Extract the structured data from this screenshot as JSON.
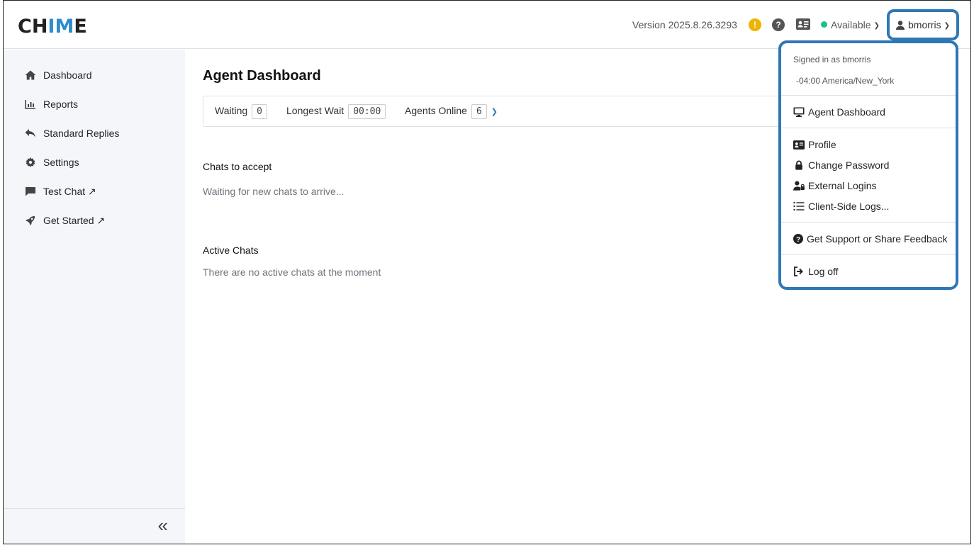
{
  "header": {
    "logo_prefix": "CH",
    "logo_highlight": "IM",
    "logo_suffix": "E",
    "version": "Version 2025.8.26.3293",
    "warning_icon": "!",
    "help_icon": "?",
    "status_label": "Available",
    "username": "bmorris"
  },
  "sidebar": {
    "items": [
      {
        "label": "Dashboard",
        "icon": "home-icon"
      },
      {
        "label": "Reports",
        "icon": "bar-chart-icon"
      },
      {
        "label": "Standard Replies",
        "icon": "reply-icon"
      },
      {
        "label": "Settings",
        "icon": "gear-icon"
      },
      {
        "label": "Test Chat ↗",
        "icon": "chat-icon"
      },
      {
        "label": "Get Started ↗",
        "icon": "rocket-icon"
      }
    ],
    "collapse_icon": "«"
  },
  "main": {
    "title": "Agent Dashboard",
    "stats": {
      "waiting_label": "Waiting",
      "waiting_value": "0",
      "longest_wait_label": "Longest Wait",
      "longest_wait_value": "00:00",
      "agents_online_label": "Agents Online",
      "agents_online_value": "6"
    },
    "chats_to_accept": {
      "heading": "Chats to accept",
      "empty_text": "Waiting for new chats to arrive..."
    },
    "active_chats": {
      "heading": "Active Chats",
      "empty_text": "There are no active chats at the moment"
    }
  },
  "user_menu": {
    "signed_in_as": "Signed in as bmorris",
    "timezone": "-04:00 America/New_York",
    "items": [
      {
        "label": "Agent Dashboard",
        "icon": "monitor-icon"
      },
      {
        "label": "Profile",
        "icon": "id-card-icon"
      },
      {
        "label": "Change Password",
        "icon": "lock-icon"
      },
      {
        "label": "External Logins",
        "icon": "user-lock-icon"
      },
      {
        "label": "Client-Side Logs...",
        "icon": "list-icon"
      },
      {
        "label": "Get Support or Share Feedback",
        "icon": "question-circle-icon"
      },
      {
        "label": "Log off",
        "icon": "sign-out-icon"
      }
    ]
  },
  "colors": {
    "accent": "#2f77b5",
    "logo_highlight": "#2d8ccf",
    "status_available": "#1cc08a",
    "warning": "#f0b400"
  }
}
